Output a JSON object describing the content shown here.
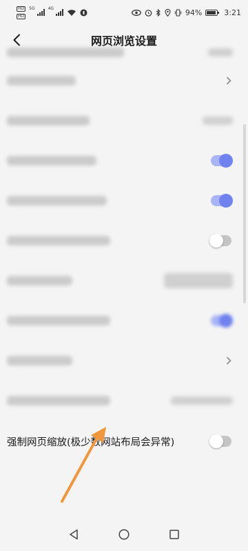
{
  "status_bar": {
    "hd1": "HD",
    "hd2": "HD",
    "net1": "5G",
    "net2": "4G",
    "battery": "94%",
    "battery_level": 0.94,
    "time": "3:21"
  },
  "header": {
    "title": "网页浏览设置"
  },
  "settings": {
    "force_zoom": {
      "label": "强制网页缩放(极少数网站布局会异常)",
      "enabled": false
    }
  },
  "colors": {
    "accent": "#6f82ee",
    "annotation_arrow": "#f0963c"
  },
  "nav_bar": {
    "back": "triangle-back-icon",
    "home": "circle-home-icon",
    "recents": "square-recents-icon"
  }
}
